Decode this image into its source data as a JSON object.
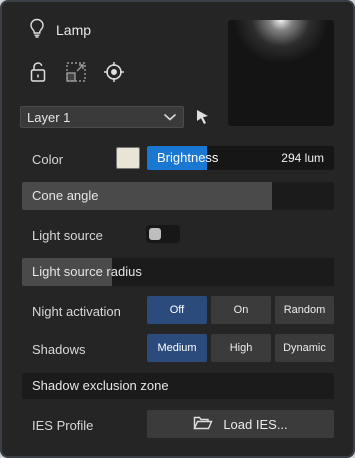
{
  "header": {
    "title": "Lamp"
  },
  "layer": {
    "selected": "Layer 1"
  },
  "color": {
    "label": "Color",
    "swatch": "#e8e4d6"
  },
  "brightness": {
    "label": "Brightness",
    "value": "294 lum",
    "fill_fraction": 0.32
  },
  "cone_angle": {
    "label": "Cone angle",
    "fill_fraction": 0.8
  },
  "light_source": {
    "label": "Light source",
    "enabled": false
  },
  "light_source_radius": {
    "label": "Light source radius",
    "fill_fraction": 0.29
  },
  "night_activation": {
    "label": "Night activation",
    "options": [
      "Off",
      "On",
      "Random"
    ],
    "selected": "Off"
  },
  "shadows": {
    "label": "Shadows",
    "options": [
      "Medium",
      "High",
      "Dynamic"
    ],
    "selected": "Medium"
  },
  "shadow_exclusion_zone": {
    "label": "Shadow exclusion zone"
  },
  "ies_profile": {
    "label": "IES Profile",
    "button_label": "Load IES..."
  },
  "icons": {
    "title": "lightbulb-icon",
    "toolbar": [
      "unlock-icon",
      "resize-icon",
      "target-icon"
    ],
    "picker": "cursor-arrow-icon",
    "dropdown": "chevron-down-icon",
    "load": "folder-open-icon"
  },
  "colors": {
    "accent": "#1a78d2",
    "segment_active": "#2c4b7d",
    "panel": "#252525"
  }
}
